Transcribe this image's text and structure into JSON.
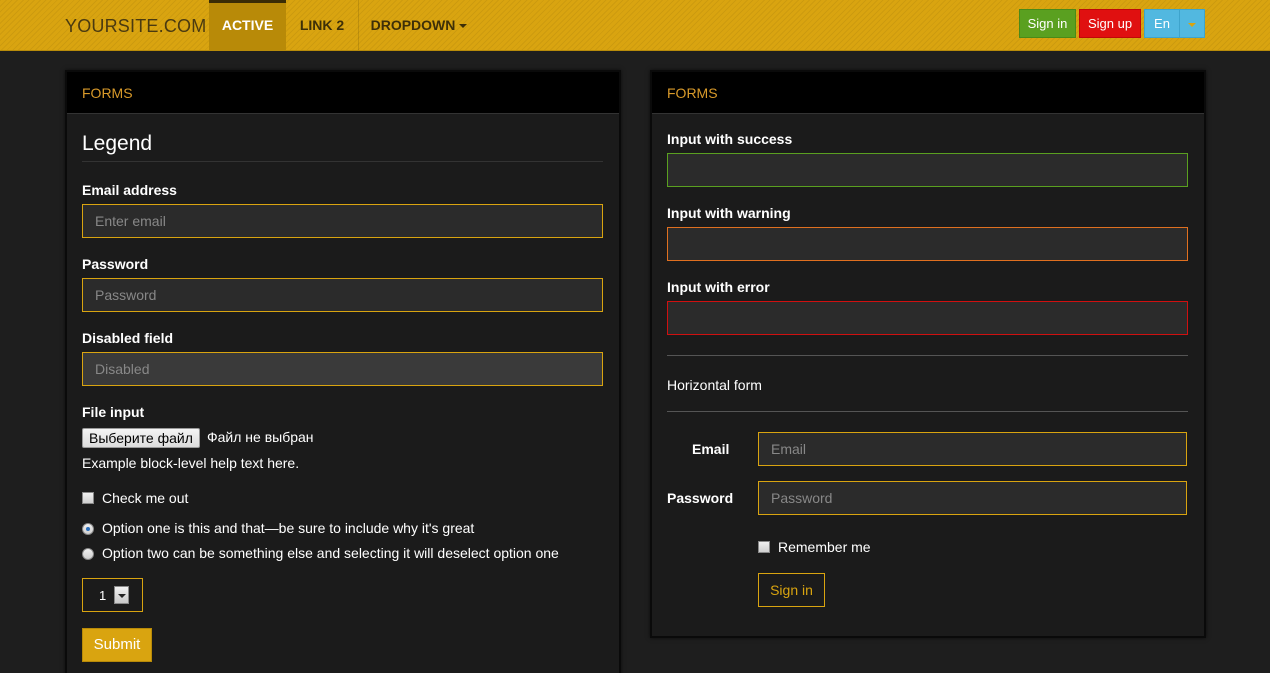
{
  "nav": {
    "brand": "YOURSITE.COM",
    "items": [
      {
        "label": "ACTIVE"
      },
      {
        "label": "LINK 2"
      },
      {
        "label": "DROPDOWN"
      }
    ],
    "signin_label": "Sign in",
    "signup_label": "Sign up",
    "lang_label": "En"
  },
  "left_panel": {
    "heading": "FORMS",
    "legend": "Legend",
    "email_label": "Email address",
    "email_placeholder": "Enter email",
    "password_label": "Password",
    "password_placeholder": "Password",
    "disabled_label": "Disabled field",
    "disabled_placeholder": "Disabled",
    "file_label": "File input",
    "file_button": "Выберите файл",
    "file_status": "Файл не выбран",
    "help_text": "Example block-level help text here.",
    "checkbox_label": "Check me out",
    "radio_one": "Option one is this and that—be sure to include why it's great",
    "radio_two": "Option two can be something else and selecting it will deselect option one",
    "select_value": "1",
    "submit_label": "Submit"
  },
  "right_panel": {
    "heading": "FORMS",
    "success_label": "Input with success",
    "warning_label": "Input with warning",
    "error_label": "Input with error",
    "horizontal_title": "Horizontal form",
    "email_label": "Email",
    "email_placeholder": "Email",
    "password_label": "Password",
    "password_placeholder": "Password",
    "remember_label": "Remember me",
    "signin_label": "Sign in"
  },
  "colors": {
    "accent": "#d9a410",
    "success": "#5aa020",
    "warning": "#e07020",
    "error": "#d01010",
    "info": "#52b8e0"
  }
}
